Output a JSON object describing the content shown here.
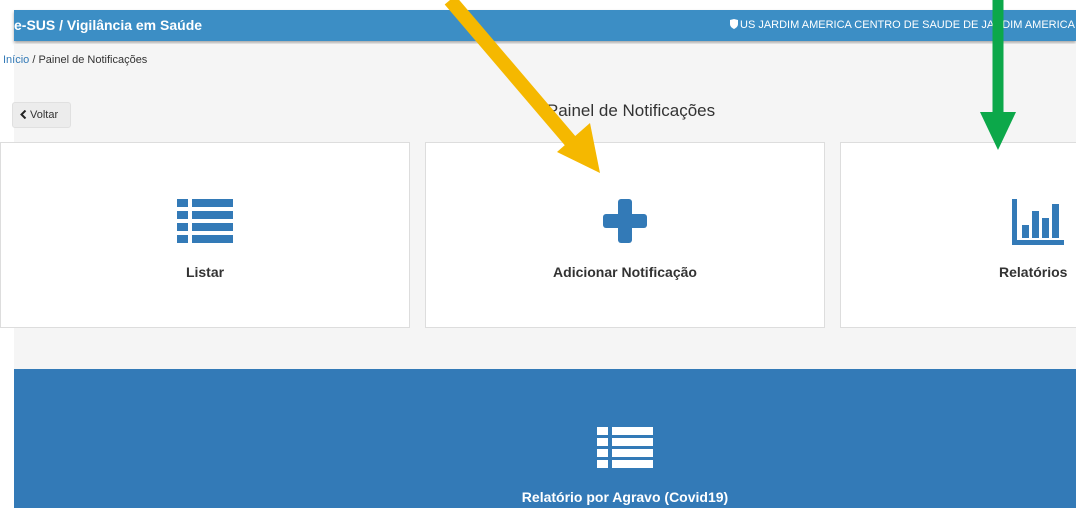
{
  "header": {
    "app_title": "e-SUS / Vigilância em Saúde",
    "unit_name": "US JARDIM AMERICA CENTRO DE SAUDE DE JARDIM AMERICA",
    "unit_icon": "shield-icon",
    "color": "#3c8ec5"
  },
  "breadcrumb": {
    "home": "Início",
    "separator": " / ",
    "current": "Painel de Notificações"
  },
  "toolbar": {
    "back_label": "Voltar",
    "back_icon": "chevron-left-icon"
  },
  "page": {
    "title": "Painel de Notificações"
  },
  "cards": [
    {
      "label": "Listar",
      "icon": "list-icon"
    },
    {
      "label": "Adicionar Notificação",
      "icon": "plus-icon"
    },
    {
      "label": "Relatórios",
      "icon": "bar-chart-icon"
    }
  ],
  "report": {
    "label": "Relatório por Agravo (Covid19)",
    "icon": "list-icon",
    "color": "#337ab7"
  },
  "colors": {
    "accent": "#337ab7",
    "annotation_yellow": "#f5b800",
    "annotation_green": "#0ca84a"
  }
}
